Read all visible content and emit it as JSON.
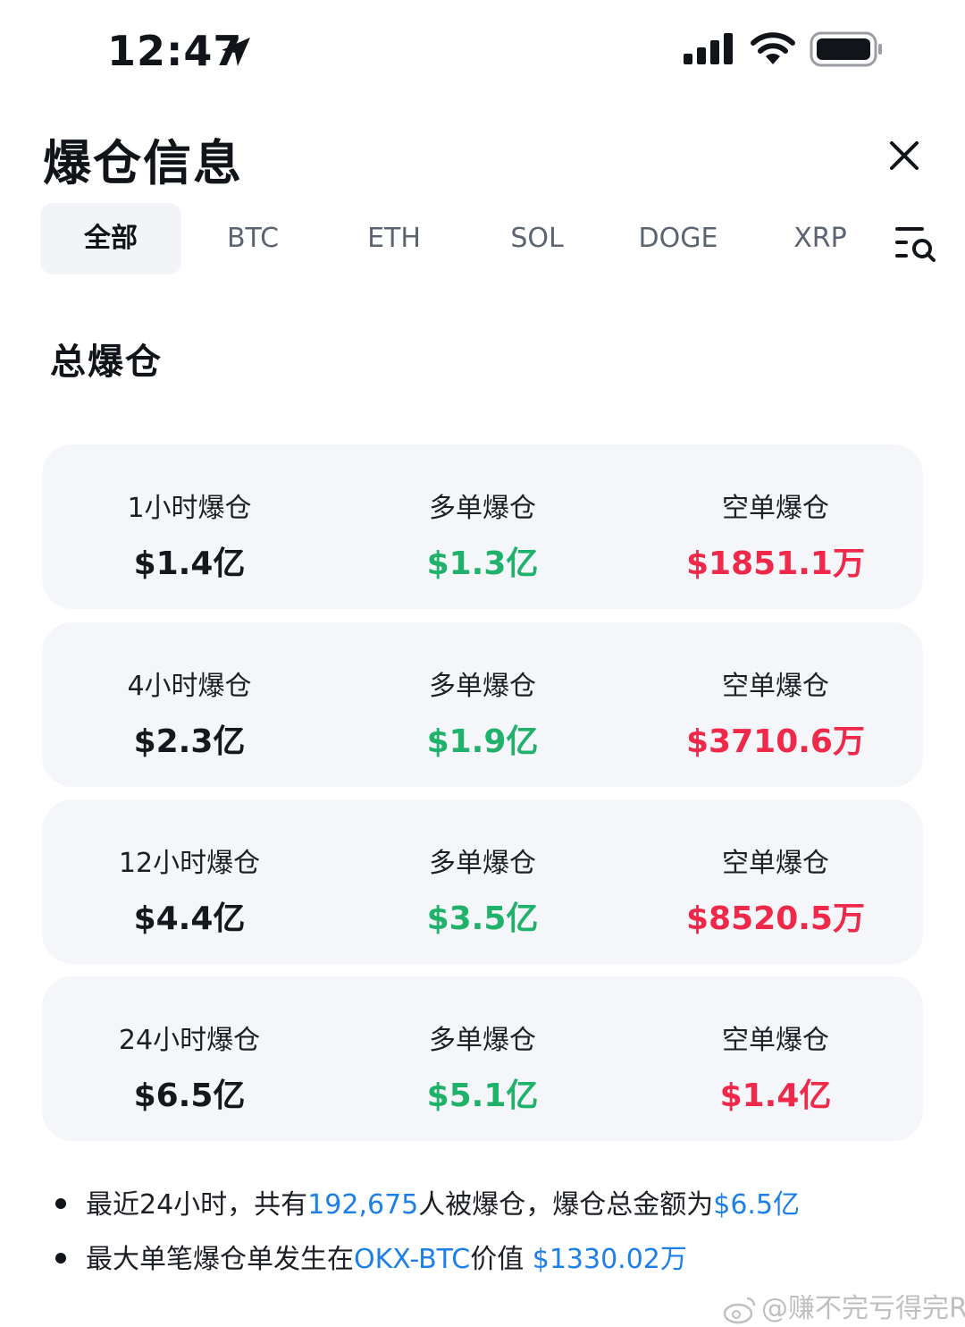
{
  "status_bar": {
    "time": "12:47"
  },
  "header": {
    "title": "爆仓信息"
  },
  "tabs": [
    {
      "label": "全部",
      "active": true
    },
    {
      "label": "BTC"
    },
    {
      "label": "ETH"
    },
    {
      "label": "SOL"
    },
    {
      "label": "DOGE"
    },
    {
      "label": "XRP"
    }
  ],
  "section": {
    "title": "总爆仓"
  },
  "cards": [
    {
      "total_label": "1小时爆仓",
      "total_value": "$1.4亿",
      "long_label": "多单爆仓",
      "long_value": "$1.3亿",
      "short_label": "空单爆仓",
      "short_value": "$1851.1万"
    },
    {
      "total_label": "4小时爆仓",
      "total_value": "$2.3亿",
      "long_label": "多单爆仓",
      "long_value": "$1.9亿",
      "short_label": "空单爆仓",
      "short_value": "$3710.6万"
    },
    {
      "total_label": "12小时爆仓",
      "total_value": "$4.4亿",
      "long_label": "多单爆仓",
      "long_value": "$3.5亿",
      "short_label": "空单爆仓",
      "short_value": "$8520.5万"
    },
    {
      "total_label": "24小时爆仓",
      "total_value": "$6.5亿",
      "long_label": "多单爆仓",
      "long_value": "$5.1亿",
      "short_label": "空单爆仓",
      "short_value": "$1.4亿"
    }
  ],
  "notes": {
    "line1": {
      "prefix": "最近24小时，共有",
      "count": "192,675",
      "middle": "人被爆仓，爆仓总金额为",
      "amount": "$6.5亿"
    },
    "line2": {
      "prefix": "最大单笔爆仓单发生在",
      "pair": "OKX-BTC",
      "middle": "价值 ",
      "amount": "$1330.02万"
    }
  },
  "watermark": "@赚不完亏得完R",
  "colors": {
    "long": "#20b26b",
    "short": "#f0294b",
    "link": "#1d7fe8",
    "card_bg": "#f4f6f9"
  }
}
